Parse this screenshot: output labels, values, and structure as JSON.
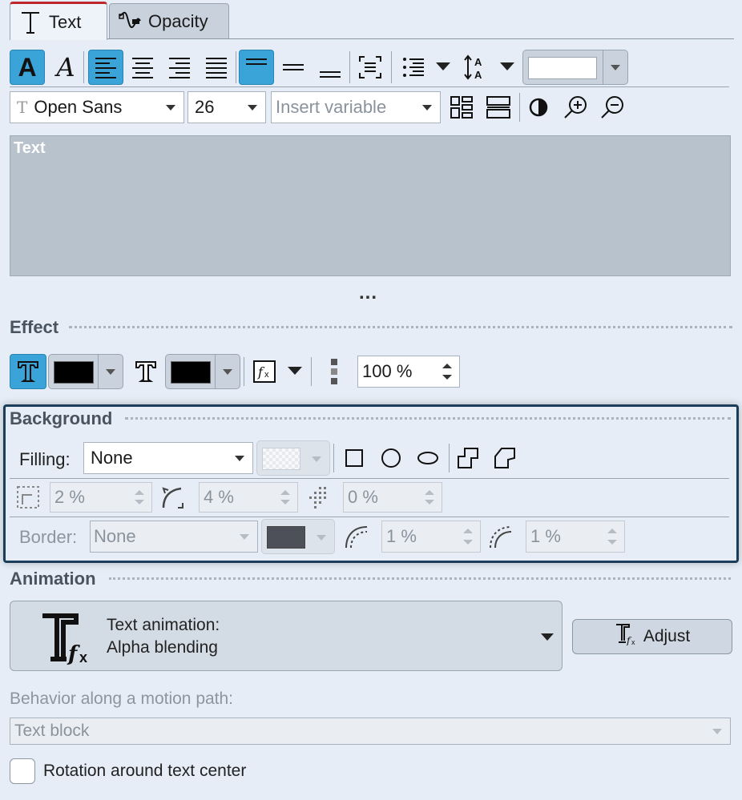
{
  "tabs": [
    {
      "label": "Text",
      "icon": "text-t-icon"
    },
    {
      "label": "Opacity",
      "icon": "opacity-wave-icon"
    }
  ],
  "toolbar2": {
    "font": "Open Sans",
    "size": "26",
    "insert_variable_placeholder": "Insert variable"
  },
  "text_area": {
    "value": "Text"
  },
  "more_label": "...",
  "effect": {
    "title": "Effect",
    "opacity_value": "100 %",
    "color1": "#000000",
    "color2": "#000000"
  },
  "background": {
    "title": "Background",
    "filling_label": "Filling:",
    "filling_value": "None",
    "margin_value": "2 %",
    "corner_value": "4 %",
    "shadow_value": "0 %",
    "border_label": "Border:",
    "border_value": "None",
    "border_color": "#4d5059",
    "border_width1": "1 %",
    "border_width2": "1 %"
  },
  "animation": {
    "title": "Animation",
    "text_animation_label": "Text animation:",
    "text_animation_value": "Alpha blending",
    "adjust_label": "Adjust",
    "motion_path_label": "Behavior along a motion path:",
    "motion_path_value": "Text block",
    "rotation_label": "Rotation around text center"
  },
  "colors": {
    "accent": "#3aa4d8",
    "highlight_border": "#1c3d5a",
    "tab_red": "#c0272d"
  }
}
